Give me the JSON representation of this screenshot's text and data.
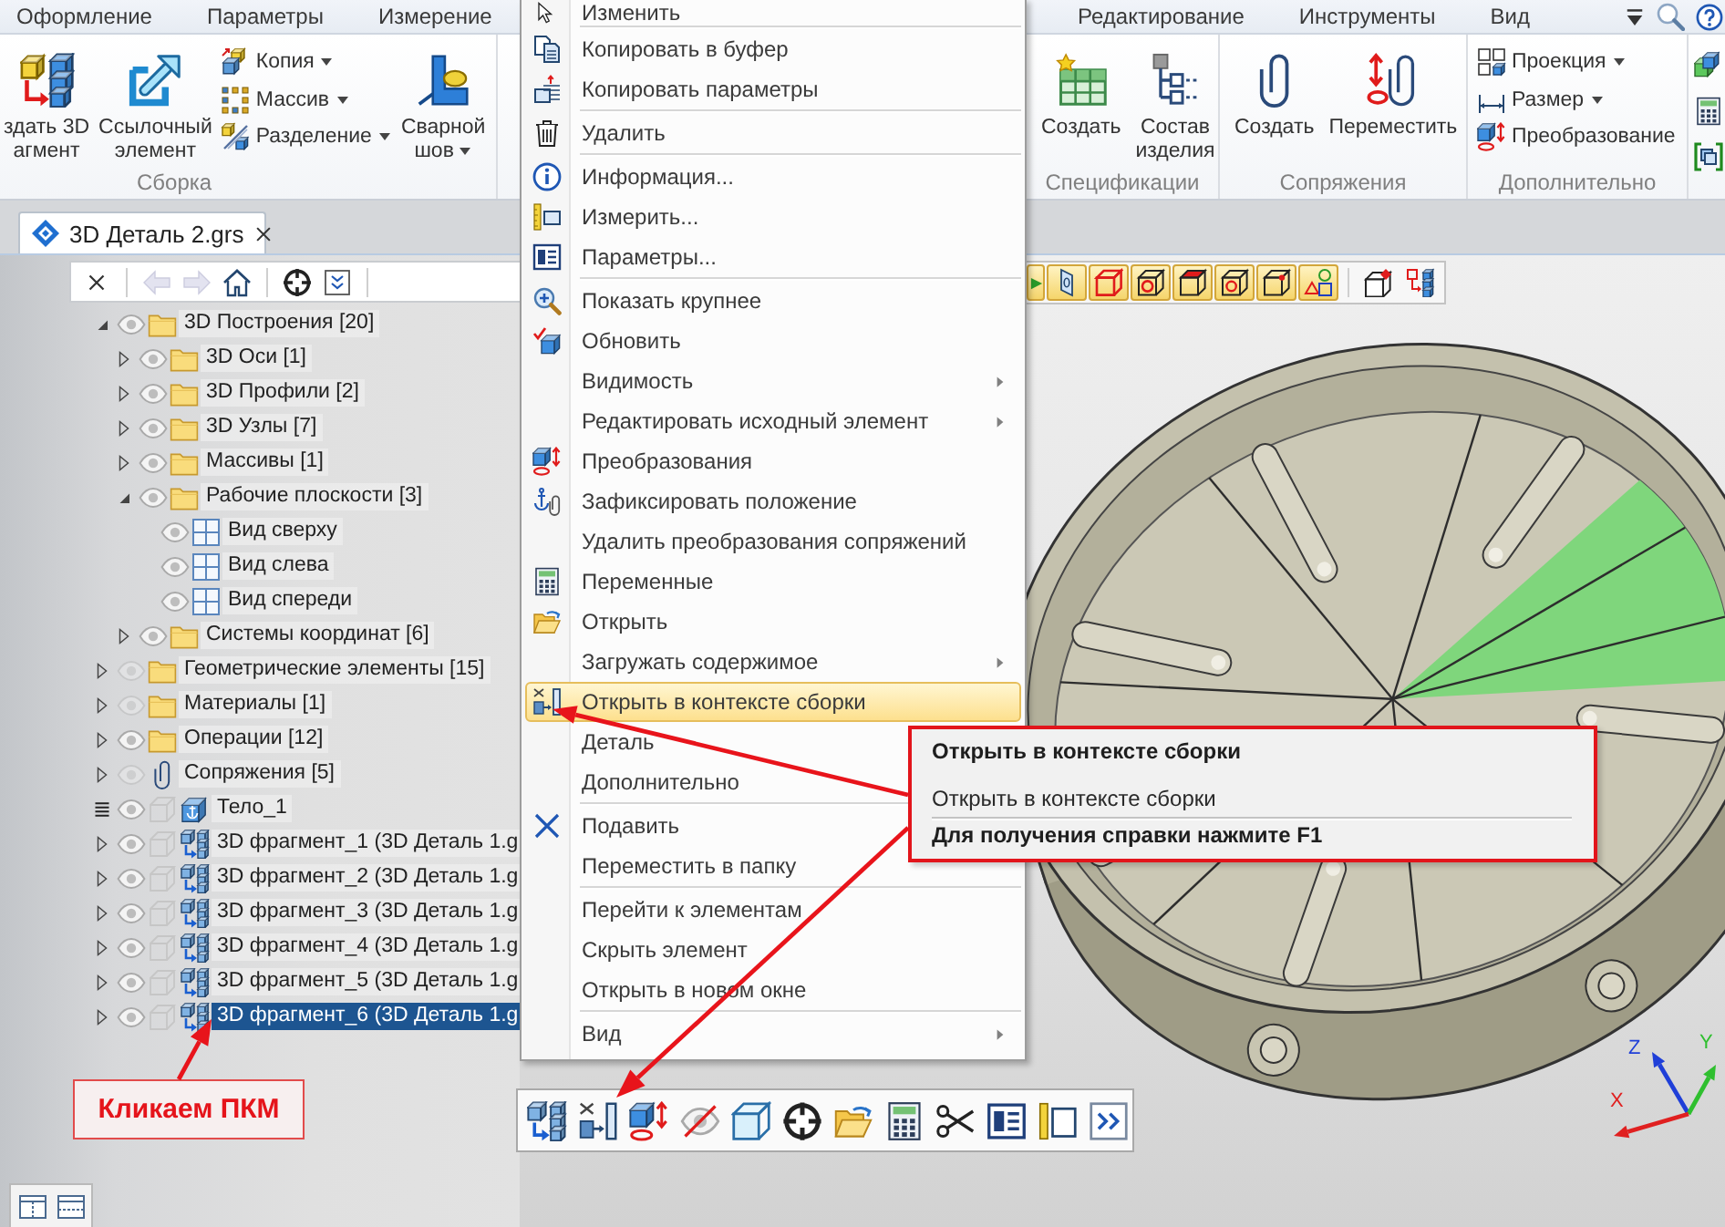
{
  "ribbon": {
    "tabs": [
      {
        "label": "Оформление",
        "selected": false
      },
      {
        "label": "Параметры",
        "selected": false
      },
      {
        "label": "Измерение",
        "selected": false
      }
    ],
    "tabs_right": [
      {
        "label": "Редактирование",
        "selected": false
      },
      {
        "label": "Инструменты",
        "selected": false
      },
      {
        "label": "Вид",
        "selected": false
      }
    ],
    "left_groups": [
      {
        "label": "Сборка",
        "buttons": [
          {
            "kind": "large",
            "label": "здать 3D\nагмент",
            "dropdown": false
          },
          {
            "kind": "large",
            "label": "Ссылочный\nэлемент",
            "dropdown": false
          },
          {
            "kind": "small",
            "label": "Копия",
            "dropdown": true
          },
          {
            "kind": "small",
            "label": "Массив",
            "dropdown": true
          },
          {
            "kind": "small",
            "label": "Разделение",
            "dropdown": true
          },
          {
            "kind": "large",
            "label": "Сварной\nшов",
            "dropdown": true
          }
        ]
      }
    ],
    "right_groups": [
      {
        "label": "Спецификации",
        "buttons": [
          {
            "kind": "large",
            "label": "Создать",
            "dropdown": false
          },
          {
            "kind": "large",
            "label": "Состав\nизделия",
            "dropdown": false
          }
        ]
      },
      {
        "label": "Сопряжения",
        "buttons": [
          {
            "kind": "large",
            "label": "Создать",
            "dropdown": false
          },
          {
            "kind": "large",
            "label": "Переместить",
            "dropdown": false
          }
        ]
      },
      {
        "label": "Дополнительно",
        "buttons": [
          {
            "kind": "small",
            "label": "Проекция",
            "dropdown": true
          },
          {
            "kind": "small",
            "label": "Размер",
            "dropdown": true
          },
          {
            "kind": "small",
            "label": "Преобразование",
            "dropdown": false
          }
        ]
      }
    ]
  },
  "document_tabs": [
    {
      "title": "3D Деталь 2.grs",
      "selected": true
    }
  ],
  "tree": {
    "toolbar": [
      {
        "disabled": false
      },
      {
        "disabled": true
      },
      {
        "disabled": true
      },
      {
        "disabled": false
      },
      {
        "disabled": false
      },
      {
        "disabled": false
      }
    ],
    "items": [
      {
        "label": "3D Построения [20]",
        "kind": "folder",
        "visible": true,
        "expanded": true,
        "selected": false,
        "children": [
          {
            "label": "3D Оси [1]",
            "kind": "folder",
            "visible": true,
            "expanded": false,
            "selected": false
          },
          {
            "label": "3D Профили [2]",
            "kind": "folder",
            "visible": true,
            "expanded": false,
            "selected": false
          },
          {
            "label": "3D Узлы [7]",
            "kind": "folder",
            "visible": true,
            "expanded": false,
            "selected": false
          },
          {
            "label": "Массивы [1]",
            "kind": "folder",
            "visible": true,
            "expanded": false,
            "selected": false
          },
          {
            "label": "Рабочие плоскости [3]",
            "kind": "folder",
            "visible": true,
            "expanded": true,
            "selected": false,
            "children": [
              {
                "label": "Вид сверху",
                "kind": "plane",
                "visible": true,
                "selected": false
              },
              {
                "label": "Вид слева",
                "kind": "plane",
                "visible": true,
                "selected": false
              },
              {
                "label": "Вид спереди",
                "kind": "plane",
                "visible": true,
                "selected": false
              }
            ]
          },
          {
            "label": "Системы координат [6]",
            "kind": "folder",
            "visible": true,
            "expanded": false,
            "selected": false
          }
        ]
      },
      {
        "label": "Геометрические элементы [15]",
        "kind": "folder",
        "visible": false,
        "expanded": false,
        "selected": false
      },
      {
        "label": "Материалы [1]",
        "kind": "folder",
        "visible": false,
        "expanded": false,
        "selected": false
      },
      {
        "label": "Операции [12]",
        "kind": "folder",
        "visible": true,
        "expanded": false,
        "selected": false
      },
      {
        "label": "Сопряжения [5]",
        "kind": "mates",
        "visible": false,
        "expanded": false,
        "selected": false
      },
      {
        "label": "Тело_1",
        "kind": "body",
        "visible": true,
        "selected": false
      },
      {
        "label": "3D фрагмент_1 (3D Деталь 1.g",
        "kind": "fragment",
        "visible": true,
        "expanded": false,
        "selected": false
      },
      {
        "label": "3D фрагмент_2 (3D Деталь 1.g",
        "kind": "fragment",
        "visible": true,
        "expanded": false,
        "selected": false
      },
      {
        "label": "3D фрагмент_3 (3D Деталь 1.g",
        "kind": "fragment",
        "visible": true,
        "expanded": false,
        "selected": false
      },
      {
        "label": "3D фрагмент_4 (3D Деталь 1.g",
        "kind": "fragment",
        "visible": true,
        "expanded": false,
        "selected": false
      },
      {
        "label": "3D фрагмент_5 (3D Деталь 1.g",
        "kind": "fragment",
        "visible": true,
        "expanded": false,
        "selected": false
      },
      {
        "label": "3D фрагмент_6 (3D Деталь 1.g",
        "kind": "fragment",
        "visible": true,
        "expanded": false,
        "selected": true
      }
    ]
  },
  "view_toolbar": [
    {
      "on": true
    },
    {
      "on": true
    },
    {
      "on": true
    },
    {
      "on": true
    },
    {
      "on": true
    },
    {
      "on": true
    },
    {
      "on": true
    },
    {
      "on": true
    },
    {
      "on": false
    },
    {
      "on": false
    }
  ],
  "menu": {
    "sections": [
      {
        "items": [
          {
            "label": "Изменить",
            "selected": false,
            "submenu": false
          }
        ]
      },
      {
        "items": [
          {
            "label": "Копировать в буфер",
            "selected": false,
            "submenu": false
          },
          {
            "label": "Копировать параметры",
            "selected": false,
            "submenu": false
          }
        ]
      },
      {
        "items": [
          {
            "label": "Удалить",
            "selected": false,
            "submenu": false
          }
        ]
      },
      {
        "items": [
          {
            "label": "Информация...",
            "selected": false,
            "submenu": false
          },
          {
            "label": "Измерить...",
            "selected": false,
            "submenu": false
          },
          {
            "label": "Параметры...",
            "selected": false,
            "submenu": false
          }
        ]
      },
      {
        "items": [
          {
            "label": "Показать крупнее",
            "selected": false,
            "submenu": false
          },
          {
            "label": "Обновить",
            "selected": false,
            "submenu": false
          },
          {
            "label": "Видимость",
            "selected": false,
            "submenu": true
          },
          {
            "label": "Редактировать исходный элемент",
            "selected": false,
            "submenu": true
          },
          {
            "label": "Преобразования",
            "selected": false,
            "submenu": false
          },
          {
            "label": "Зафиксировать положение",
            "selected": false,
            "submenu": false
          },
          {
            "label": "Удалить преобразования сопряжений",
            "selected": false,
            "submenu": false
          },
          {
            "label": "Переменные",
            "selected": false,
            "submenu": false
          },
          {
            "label": "Открыть",
            "selected": false,
            "submenu": false
          },
          {
            "label": "Загружать содержимое",
            "selected": false,
            "submenu": true
          },
          {
            "label": "Открыть в контексте сборки",
            "selected": true,
            "submenu": false
          },
          {
            "label": "Деталь",
            "selected": false,
            "submenu": false
          },
          {
            "label": "Дополнительно",
            "selected": false,
            "submenu": false
          }
        ]
      },
      {
        "items": [
          {
            "label": "Подавить",
            "selected": false,
            "submenu": false
          },
          {
            "label": "Переместить в папку",
            "selected": false,
            "submenu": false
          }
        ]
      },
      {
        "items": [
          {
            "label": "Перейти к элементам",
            "selected": false,
            "submenu": false
          },
          {
            "label": "Скрыть элемент",
            "selected": false,
            "submenu": false
          },
          {
            "label": "Открыть в новом окне",
            "selected": false,
            "submenu": false
          }
        ]
      },
      {
        "items": [
          {
            "label": "Вид",
            "selected": false,
            "submenu": true
          }
        ]
      }
    ]
  },
  "tooltip": {
    "title": "Открыть в контексте сборки",
    "description": "Открыть в контексте сборки",
    "help": "Для получения справки нажмите F1"
  },
  "callout": {
    "text": "Кликаем ПКМ"
  },
  "axes": [
    {
      "label": "Z",
      "color": "#1f3fd8"
    },
    {
      "label": "Y",
      "color": "#2fbf2f"
    },
    {
      "label": "X",
      "color": "#e02020"
    }
  ]
}
